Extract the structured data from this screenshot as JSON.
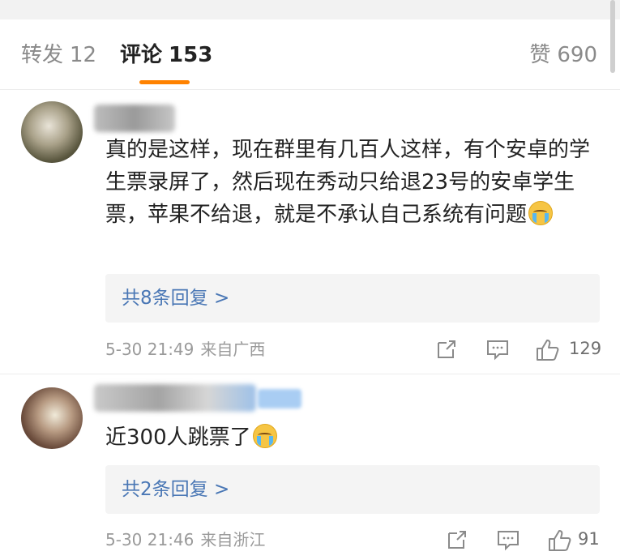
{
  "tabs": {
    "repost": {
      "label": "转发",
      "count": "12"
    },
    "comments": {
      "label": "评论",
      "count": "153"
    },
    "likes": {
      "label": "赞",
      "count": "690"
    }
  },
  "comments": [
    {
      "text": "真的是这样，现在群里有几百人这样，有个安卓的学生票录屏了，然后现在秀动只给退23号的安卓学生票，苹果不给退，就是不承认自己系统有问题",
      "emoji": "cry-icon",
      "replies_label": "共8条回复 >",
      "time": "5-30 21:49",
      "location": "来自广西",
      "likes": "129"
    },
    {
      "text": "近300人跳票了",
      "emoji": "cry-icon",
      "replies_label": "共2条回复 >",
      "time": "5-30 21:46",
      "location": "来自浙江",
      "likes": "91"
    }
  ],
  "colors": {
    "accent": "#ff8200",
    "link": "#4a77b5",
    "muted": "#9a9a9a"
  }
}
